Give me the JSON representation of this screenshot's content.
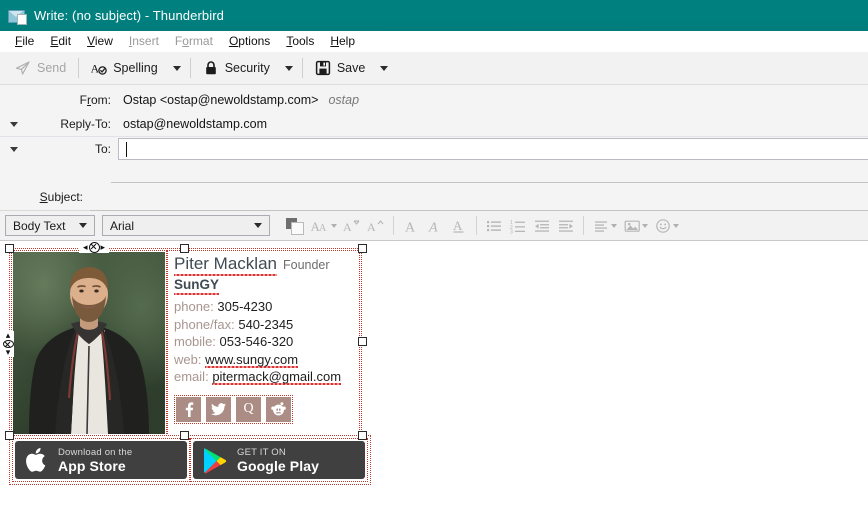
{
  "window": {
    "title": "Write: (no subject) - Thunderbird",
    "icon": "compose-message-icon",
    "titlebar_color": "#00807f"
  },
  "menubar": {
    "items": [
      {
        "label": "File",
        "accel": "F",
        "disabled": false
      },
      {
        "label": "Edit",
        "accel": "E",
        "disabled": false
      },
      {
        "label": "View",
        "accel": "V",
        "disabled": false
      },
      {
        "label": "Insert",
        "accel": "I",
        "disabled": true
      },
      {
        "label": "Format",
        "accel": "o",
        "disabled": true
      },
      {
        "label": "Options",
        "accel": "O",
        "disabled": false
      },
      {
        "label": "Tools",
        "accel": "T",
        "disabled": false
      },
      {
        "label": "Help",
        "accel": "H",
        "disabled": false
      }
    ]
  },
  "toolbar": {
    "send_label": "Send",
    "send_disabled": true,
    "spelling_label": "Spelling",
    "security_label": "Security",
    "save_label": "Save"
  },
  "headers": {
    "from": {
      "label": "From:",
      "value": "Ostap <ostap@newoldstamp.com>",
      "identity": "ostap"
    },
    "reply_to": {
      "label": "Reply-To:",
      "value": "ostap@newoldstamp.com"
    },
    "to": {
      "label": "To:",
      "value": "",
      "focused": true
    },
    "subject": {
      "label": "Subject:",
      "value": ""
    }
  },
  "format_toolbar": {
    "paragraph_style": "Body Text",
    "font_family": "Arial",
    "buttons": [
      {
        "name": "text-color-swatch",
        "label": "Text & background color"
      },
      {
        "name": "font-size-menu",
        "label": "AA"
      },
      {
        "name": "decrease-font-size",
        "label": "A"
      },
      {
        "name": "increase-font-size",
        "label": "A"
      },
      {
        "name": "bold",
        "label": "A"
      },
      {
        "name": "italic",
        "label": "A"
      },
      {
        "name": "underline",
        "label": "A"
      },
      {
        "name": "bulleted-list",
        "label": ""
      },
      {
        "name": "numbered-list",
        "label": ""
      },
      {
        "name": "outdent",
        "label": ""
      },
      {
        "name": "indent",
        "label": ""
      },
      {
        "name": "align-menu",
        "label": ""
      },
      {
        "name": "insert-image-menu",
        "label": ""
      },
      {
        "name": "emoticon-menu",
        "label": ""
      }
    ]
  },
  "signature": {
    "selected": true,
    "photo_alt": "portrait-of-bearded-man-in-leather-jacket",
    "name": "Piter Macklan",
    "role": "Founder",
    "company": "SunGY",
    "rows": [
      {
        "label": "phone:",
        "value": "305-4230"
      },
      {
        "label": "phone/fax:",
        "value": "540-2345"
      },
      {
        "label": "mobile:",
        "value": "053-546-320"
      },
      {
        "label": "web:",
        "value": "www.sungy.com"
      },
      {
        "label": "email:",
        "value": "pitermack@gmail.com"
      }
    ],
    "socials": [
      {
        "name": "facebook-icon",
        "glyph": "f"
      },
      {
        "name": "twitter-icon",
        "glyph": "✉"
      },
      {
        "name": "quora-icon",
        "glyph": "Q"
      },
      {
        "name": "reddit-icon",
        "glyph": "▣"
      }
    ],
    "social_color": "#ab8d85",
    "label_color": "#a8958f",
    "name_color": "#3f4a52",
    "badges": [
      {
        "name": "app-store-badge",
        "line1": "Download on the",
        "line2": "App Store",
        "icon": "apple-logo"
      },
      {
        "name": "google-play-badge",
        "line1": "GET IT ON",
        "line2": "Google Play",
        "icon": "google-play-logo"
      }
    ]
  }
}
